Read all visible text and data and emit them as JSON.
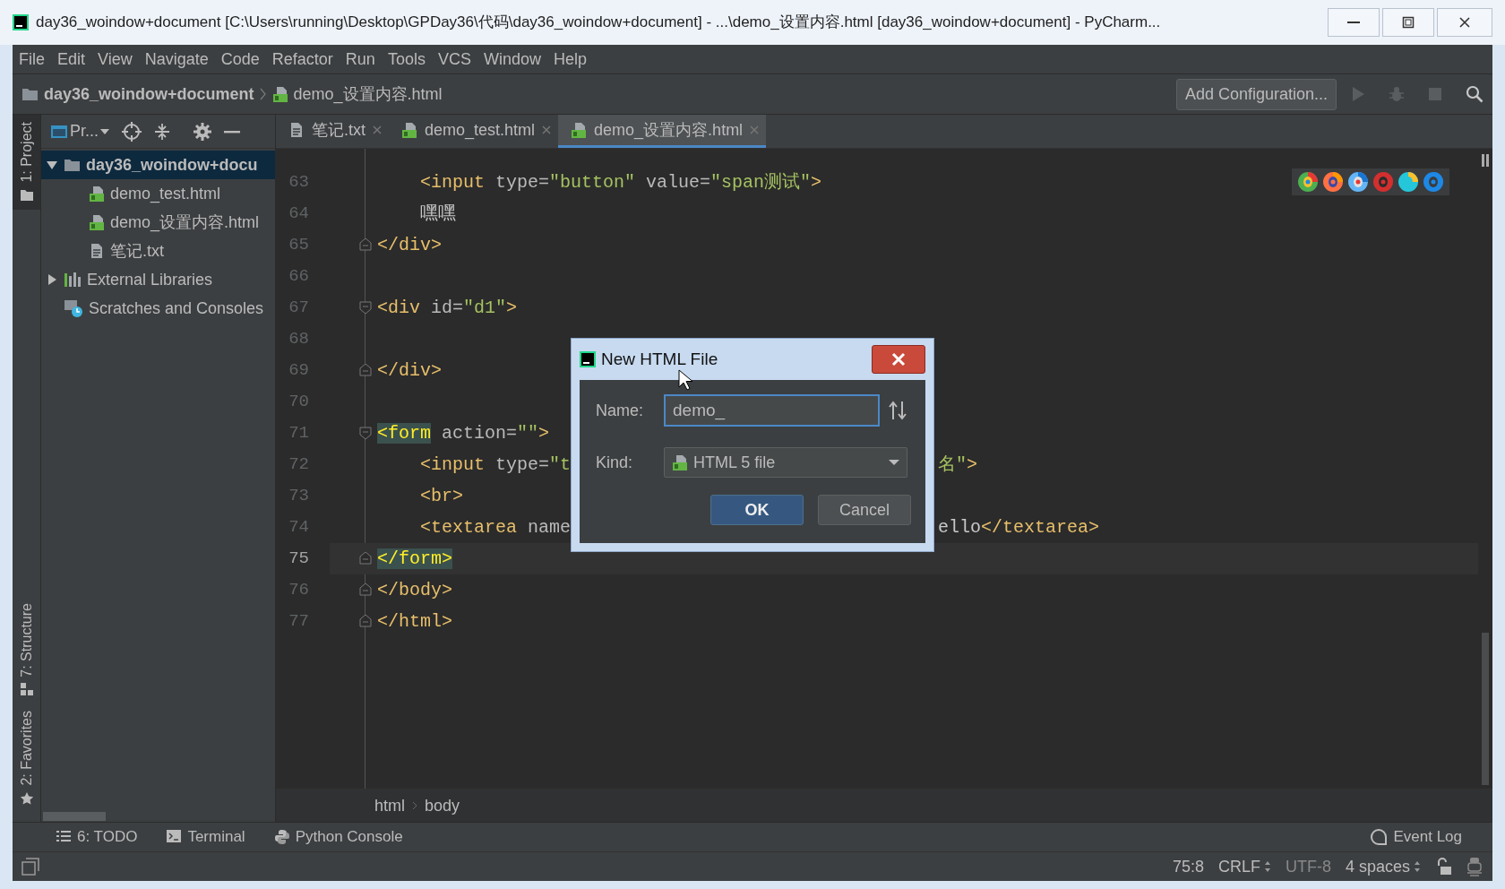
{
  "window": {
    "title": "day36_woindow+document [C:\\Users\\running\\Desktop\\GPDay36\\代码\\day36_woindow+document] - ...\\demo_设置内容.html [day36_woindow+document] - PyCharm..."
  },
  "menu": [
    "File",
    "Edit",
    "View",
    "Navigate",
    "Code",
    "Refactor",
    "Run",
    "Tools",
    "VCS",
    "Window",
    "Help"
  ],
  "navbar": {
    "project": "day36_woindow+document",
    "file": "demo_设置内容.html",
    "run_config": "Add Configuration..."
  },
  "side_stripe": [
    {
      "label": "1: Project",
      "kind": "project",
      "selected": true
    },
    {
      "label": "7: Structure",
      "kind": "structure",
      "selected": false
    },
    {
      "label": "2: Favorites",
      "kind": "favorites",
      "selected": false
    }
  ],
  "project_panel": {
    "title": "Pr...",
    "tree": [
      {
        "label": "day36_woindow+docu",
        "kind": "folder",
        "expanded": true,
        "selected": true,
        "children": [
          {
            "label": "demo_test.html",
            "kind": "html",
            "selected": false
          },
          {
            "label": "demo_设置内容.html",
            "kind": "html",
            "selected": false
          },
          {
            "label": "笔记.txt",
            "kind": "text",
            "selected": false
          }
        ]
      },
      {
        "label": "External Libraries",
        "kind": "library",
        "expanded": false,
        "selected": false
      },
      {
        "label": "Scratches and Consoles",
        "kind": "scratch",
        "selected": false
      }
    ]
  },
  "tabs": [
    {
      "label": "笔记.txt",
      "kind": "text",
      "selected": false
    },
    {
      "label": "demo_test.html",
      "kind": "html",
      "selected": false
    },
    {
      "label": "demo_设置内容.html",
      "kind": "html",
      "selected": true
    }
  ],
  "editor": {
    "lines": [
      {
        "number": "63",
        "current": false,
        "kind": "plain",
        "code": [
          {
            "kind": "tag",
            "text": "    <input"
          },
          {
            "kind": "attr",
            "text": " type="
          },
          {
            "kind": "str",
            "text": "\"button\""
          },
          {
            "kind": "attr",
            "text": " value="
          },
          {
            "kind": "str",
            "text": "\"span测试\""
          },
          {
            "kind": "tag",
            "text": ">"
          }
        ]
      },
      {
        "number": "64",
        "current": false,
        "kind": "plain",
        "code": [
          {
            "kind": "text",
            "text": "    嘿嘿"
          }
        ]
      },
      {
        "number": "65",
        "current": false,
        "kind": "fold-end",
        "code": [
          {
            "kind": "tag",
            "text": "</div>"
          }
        ]
      },
      {
        "number": "66",
        "current": false,
        "kind": "plain"
      },
      {
        "number": "67",
        "current": false,
        "kind": "fold-start",
        "code": [
          {
            "kind": "tag",
            "text": "<div"
          },
          {
            "kind": "attr",
            "text": " id="
          },
          {
            "kind": "str",
            "text": "\"d1\""
          },
          {
            "kind": "tag",
            "text": ">"
          }
        ]
      },
      {
        "number": "68",
        "current": false,
        "kind": "plain"
      },
      {
        "number": "69",
        "current": false,
        "kind": "fold-end",
        "code": [
          {
            "kind": "tag",
            "text": "</div>"
          }
        ]
      },
      {
        "number": "70",
        "current": false,
        "kind": "plain"
      },
      {
        "number": "71",
        "current": false,
        "kind": "fold-start",
        "code": [
          {
            "kind": "match",
            "text": "<form"
          },
          {
            "kind": "attr",
            "text": " action="
          },
          {
            "kind": "str",
            "text": "\"\""
          },
          {
            "kind": "tag",
            "text": ">"
          }
        ]
      },
      {
        "number": "72",
        "current": false,
        "kind": "plain",
        "code": [
          {
            "kind": "tag",
            "text": "    <input"
          },
          {
            "kind": "attr",
            "text": " type="
          },
          {
            "kind": "str",
            "text": "\"t"
          }
        ],
        "code_right": [
          {
            "kind": "str",
            "text": "名\""
          },
          {
            "kind": "tag",
            "text": ">"
          }
        ]
      },
      {
        "number": "73",
        "current": false,
        "kind": "plain",
        "code": [
          {
            "kind": "tag",
            "text": "    <br>"
          }
        ]
      },
      {
        "number": "74",
        "current": false,
        "kind": "plain",
        "code": [
          {
            "kind": "tag",
            "text": "    <textarea"
          },
          {
            "kind": "attr",
            "text": " name"
          }
        ],
        "code_right": [
          {
            "kind": "text",
            "text": "ello"
          },
          {
            "kind": "tag",
            "text": "</textarea>"
          }
        ]
      },
      {
        "number": "75",
        "current": true,
        "kind": "fold-end",
        "code": [
          {
            "kind": "match",
            "text": "</form>"
          }
        ]
      },
      {
        "number": "76",
        "current": false,
        "kind": "fold-end",
        "code": [
          {
            "kind": "tag",
            "text": "</body>"
          }
        ]
      },
      {
        "number": "77",
        "current": false,
        "kind": "fold-end",
        "code": [
          {
            "kind": "tag",
            "text": "</html>"
          }
        ]
      }
    ],
    "breadcrumb": [
      "html",
      "body"
    ]
  },
  "dialog": {
    "title": "New HTML File",
    "name_label": "Name:",
    "name_value": "demo_",
    "kind_label": "Kind:",
    "kind_value": "HTML 5 file",
    "ok": "OK",
    "cancel": "Cancel"
  },
  "bottom_tools": [
    {
      "label": "6: TODO",
      "kind": "todo"
    },
    {
      "label": "Terminal",
      "kind": "terminal"
    },
    {
      "label": "Python Console",
      "kind": "console"
    }
  ],
  "event_log": "Event Log",
  "status_bar": {
    "position": "75:8",
    "line_separator": "CRLF",
    "encoding": "UTF-8",
    "indent": "4 spaces"
  }
}
